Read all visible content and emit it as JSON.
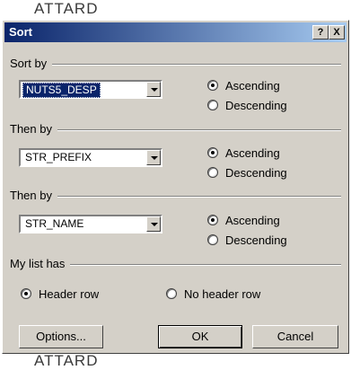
{
  "background": {
    "top_text": "ATTARD",
    "bottom_text": "ATTARD"
  },
  "dialog": {
    "title": "Sort",
    "help_button": "?",
    "close_button": "X",
    "sort_by": {
      "label": "Sort by",
      "field": "NUTS5_DESP",
      "ascending": "Ascending",
      "descending": "Descending",
      "selected": "ascending"
    },
    "then_by_1": {
      "label": "Then by",
      "field": "STR_PREFIX",
      "ascending": "Ascending",
      "descending": "Descending",
      "selected": "ascending"
    },
    "then_by_2": {
      "label": "Then by",
      "field": "STR_NAME",
      "ascending": "Ascending",
      "descending": "Descending",
      "selected": "ascending"
    },
    "my_list_has": {
      "label": "My list has",
      "header_row": "Header row",
      "no_header_row": "No header row",
      "selected": "header_row"
    },
    "buttons": {
      "options": "Options...",
      "ok": "OK",
      "cancel": "Cancel"
    }
  }
}
